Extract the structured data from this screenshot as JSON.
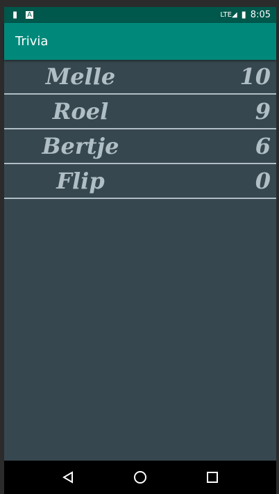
{
  "status": {
    "time": "8:05",
    "icons": [
      "sd-card-icon",
      "notification-a-icon",
      "lte-signal-icon",
      "battery-charging-icon"
    ]
  },
  "appbar": {
    "title": "Trivia"
  },
  "scores": [
    {
      "name": "Melle",
      "score": "10"
    },
    {
      "name": "Roel",
      "score": "9"
    },
    {
      "name": "Bertje",
      "score": "6"
    },
    {
      "name": "Flip",
      "score": "0"
    }
  ],
  "nav": {
    "icons": [
      "back-icon",
      "home-icon",
      "recents-icon"
    ]
  }
}
